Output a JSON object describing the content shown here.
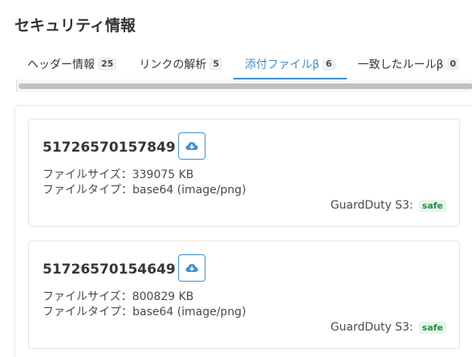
{
  "page": {
    "title": "セキュリティ情報"
  },
  "tabs": [
    {
      "label": "ヘッダー情報",
      "count": "25"
    },
    {
      "label": "リンクの解析",
      "count": "5"
    },
    {
      "label": "添付ファイルβ",
      "count": "6"
    },
    {
      "label": "一致したルールβ",
      "count": "0"
    }
  ],
  "active_tab": "添付ファイルβ",
  "attachments": [
    {
      "name": "51726570157849",
      "size_label": "ファイルサイズ：",
      "size_value": "339075 KB",
      "type_label": "ファイルタイプ：",
      "type_value": "base64 (image/png)",
      "scan_label": "GuardDuty S3:",
      "scan_status": "safe"
    },
    {
      "name": "51726570154649",
      "size_label": "ファイルサイズ：",
      "size_value": "800829 KB",
      "type_label": "ファイルタイプ：",
      "type_value": "base64 (image/png)",
      "scan_label": "GuardDuty S3:",
      "scan_status": "safe"
    }
  ],
  "icons": {
    "download": "cloud-download-icon"
  },
  "colors": {
    "accent": "#3e8ed0",
    "safe_bg": "#e4f7ea",
    "safe_text": "#2e8a4a"
  }
}
